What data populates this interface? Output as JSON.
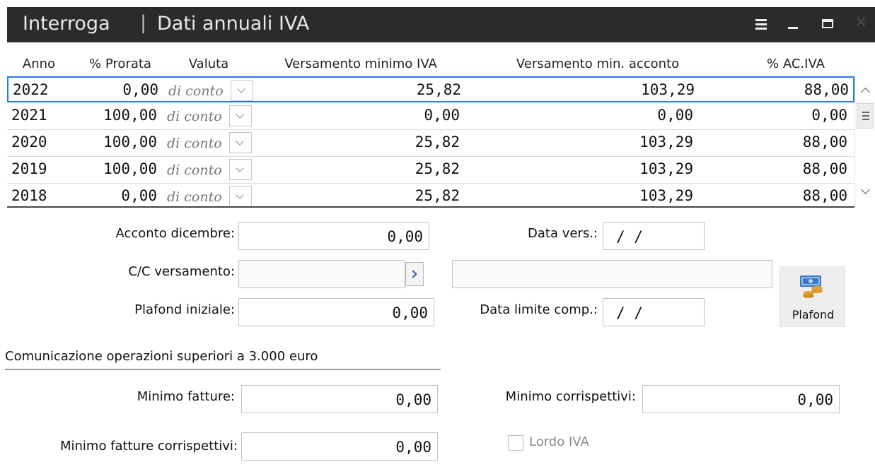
{
  "window": {
    "app_title": "Interroga",
    "separator": "|",
    "doc_title": "Dati annuali IVA",
    "icons": [
      "menu-icon",
      "minimize-icon",
      "maximize-icon",
      "close-icon"
    ],
    "close_glyph": "✕"
  },
  "grid": {
    "columns": [
      "Anno",
      "% Prorata",
      "Valuta",
      "Versamento minimo IVA",
      "Versamento min. acconto",
      "% AC.IVA"
    ],
    "rows": [
      {
        "anno": "2022",
        "prorata": "0,00",
        "valuta": "di conto",
        "vers_min": "25,82",
        "vers_acc": "103,29",
        "ac_iva": "88,00"
      },
      {
        "anno": "2021",
        "prorata": "100,00",
        "valuta": "di conto",
        "vers_min": "0,00",
        "vers_acc": "0,00",
        "ac_iva": "0,00"
      },
      {
        "anno": "2020",
        "prorata": "100,00",
        "valuta": "di conto",
        "vers_min": "25,82",
        "vers_acc": "103,29",
        "ac_iva": "88,00"
      },
      {
        "anno": "2019",
        "prorata": "100,00",
        "valuta": "di conto",
        "vers_min": "25,82",
        "vers_acc": "103,29",
        "ac_iva": "88,00"
      },
      {
        "anno": "2018",
        "prorata": "0,00",
        "valuta": "di conto",
        "vers_min": "25,82",
        "vers_acc": "103,29",
        "ac_iva": "88,00"
      }
    ],
    "selected_row": 0
  },
  "form": {
    "acconto_dicembre": {
      "label": "Acconto dicembre:",
      "value": "0,00"
    },
    "data_vers": {
      "label": "Data vers.:",
      "value": "/ /"
    },
    "cc_versamento": {
      "label": "C/C versamento:",
      "value": "",
      "description": ""
    },
    "plafond_iniziale": {
      "label": "Plafond iniziale:",
      "value": "0,00"
    },
    "data_limite_comp": {
      "label": "Data limite comp.:",
      "value": "/ /"
    },
    "plafond_button": {
      "label": "Plafond",
      "icon": "money-coins-icon"
    }
  },
  "section": {
    "title": "Comunicazione operazioni superiori a 3.000 euro",
    "minimo_fatture": {
      "label": "Minimo fatture:",
      "value": "0,00"
    },
    "minimo_corrispettivi": {
      "label": "Minimo corrispettivi:",
      "value": "0,00"
    },
    "minimo_fatture_corrispettivi": {
      "label": "Minimo fatture corrispettivi:",
      "value": "0,00"
    },
    "lordo_iva": {
      "label": "Lordo IVA",
      "checked": false,
      "enabled": false
    }
  },
  "colors": {
    "titlebar": "#2b2b2b",
    "selection": "#2a7bd8",
    "coin_gold": "#e0a53a",
    "note_blue": "#3b77c4"
  }
}
